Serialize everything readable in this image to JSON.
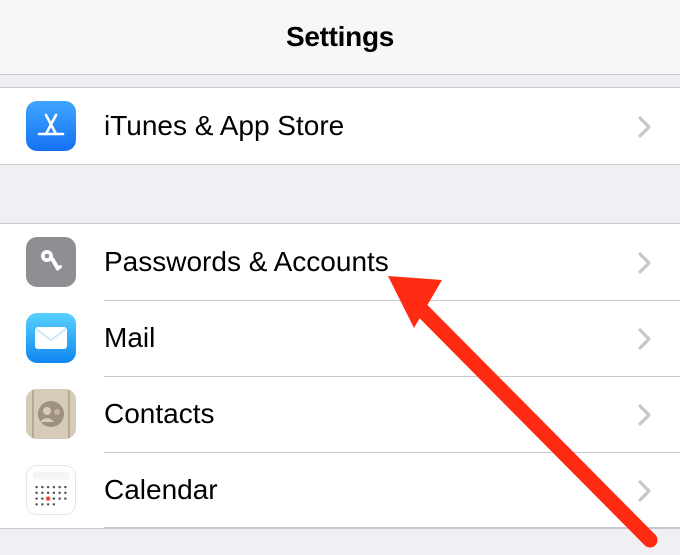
{
  "header": {
    "title": "Settings"
  },
  "groups": [
    {
      "rows": [
        {
          "id": "itunes",
          "label": "iTunes & App Store",
          "icon": "app-store-icon",
          "icon_bg": "#1e88ff"
        }
      ]
    },
    {
      "rows": [
        {
          "id": "passwords",
          "label": "Passwords & Accounts",
          "icon": "key-icon",
          "icon_bg": "#8e8e93"
        },
        {
          "id": "mail",
          "label": "Mail",
          "icon": "mail-icon",
          "icon_bg": "#1badf8"
        },
        {
          "id": "contacts",
          "label": "Contacts",
          "icon": "contacts-icon",
          "icon_bg": "#b6a693"
        },
        {
          "id": "calendar",
          "label": "Calendar",
          "icon": "calendar-icon",
          "icon_bg": "#ffffff"
        }
      ]
    }
  ],
  "annotation": {
    "type": "arrow",
    "target": "passwords",
    "color": "#ff2a12"
  }
}
